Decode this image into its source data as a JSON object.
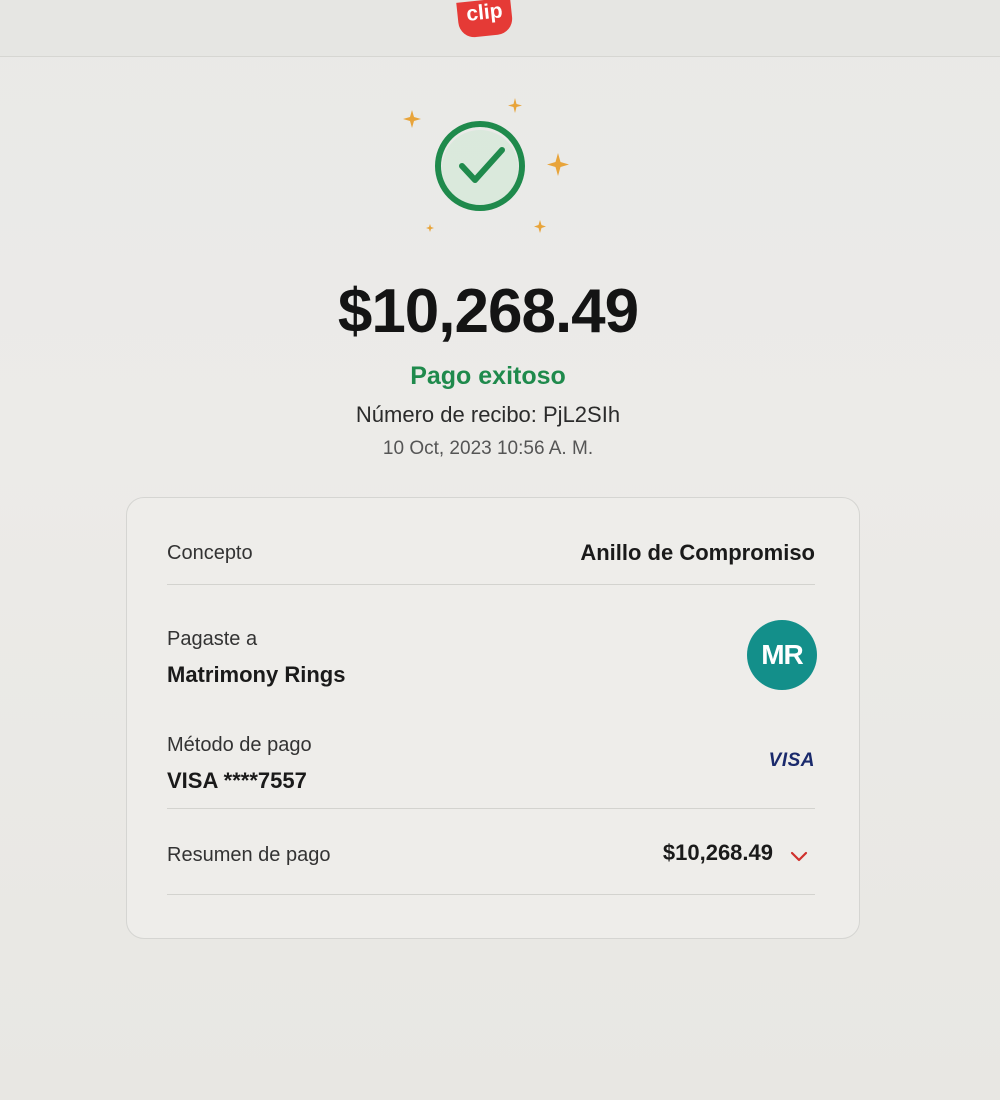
{
  "header": {
    "logo_text": "clip",
    "logo_color": "#e53a36"
  },
  "hero": {
    "icon": "check-circle-icon",
    "icon_color": "#1f8a4c",
    "sparkle_color": "#e8a43a"
  },
  "payment": {
    "amount": "$10,268.49",
    "status": "Pago exitoso",
    "receipt": "Número de recibo: PjL2SIh",
    "datetime": "10 Oct, 2023 10:56 A. M."
  },
  "details": {
    "concept_label": "Concepto",
    "concept_value": "Anillo de Compromiso",
    "paid_to_label": "Pagaste a",
    "paid_to_value": "Matrimony Rings",
    "avatar_initials": "MR",
    "avatar_color": "#138f8a",
    "method_label": "Método de pago",
    "method_value": "VISA ****7557",
    "card_brand": "VISA",
    "summary_label": "Resumen de pago",
    "summary_value": "$10,268.49",
    "expand_icon": "chevron-down-icon"
  }
}
